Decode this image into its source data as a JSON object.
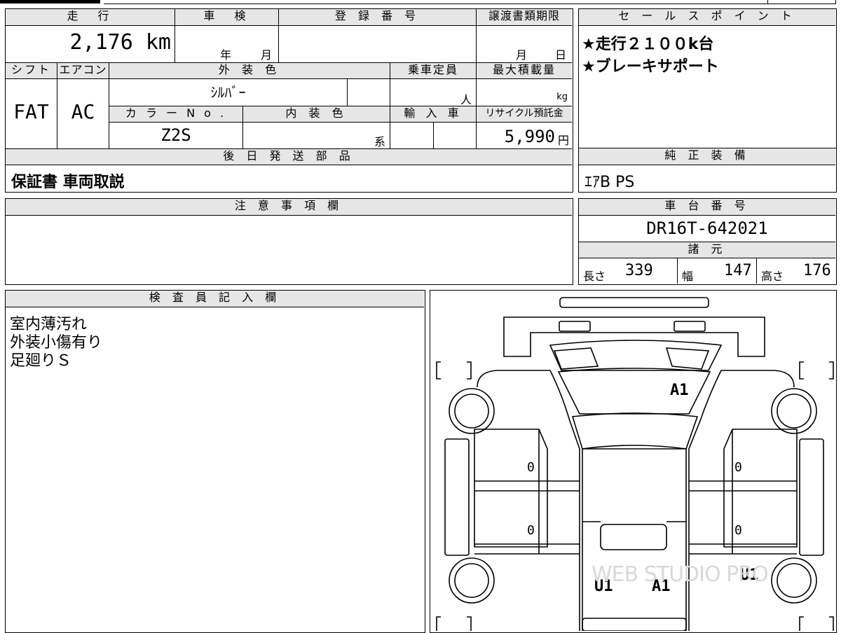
{
  "top_left": {
    "mileage_label": "走　行",
    "mileage_value": "2,176 km",
    "inspection_label": "車　検",
    "year_label": "年",
    "month_label": "月",
    "registration_label": "登 録 番 号",
    "transfer_label": "譲渡書類期限",
    "transfer_month": "月",
    "transfer_day": "日",
    "shift_label": "シフト",
    "ac_label": "エアコン",
    "exterior_label": "外 装 色",
    "capacity_label": "乗車定員",
    "capacity_unit": "人",
    "maxload_label": "最大積載量",
    "maxload_unit": "kg",
    "shift_value": "FAT",
    "ac_value": "AC",
    "exterior_value": "ｼﾙﾊﾞｰ",
    "color_no_label": "カ ラ ー  N o .",
    "interior_label": "内 装 色",
    "import_label": "輸 入 車",
    "recycle_label": "リサイクル預託金",
    "color_no_value": "Z2S",
    "interior_suffix": "系",
    "recycle_value": "5,990",
    "recycle_unit": "円",
    "later_parts_label": "後 日 発 送 部 品",
    "later_parts_value": "保証書 車両取説",
    "notes_label": "注 意 事 項 欄",
    "inspector_label": "検 査 員 記 入 欄",
    "inspector_lines": [
      "室内薄汚れ",
      "外装小傷有り",
      "足廻りＳ"
    ]
  },
  "right": {
    "sales_label": "セ ー ル ス ポ イ ン ト",
    "sales_lines": [
      "★走行２１００k台",
      "★ブレーキサポート"
    ],
    "equipment_label": "純 正 装 備",
    "equipment_value": "ｴｱB PS",
    "chassis_label": "車 台 番 号",
    "chassis_value": "DR16T-642021",
    "specs_label": "諸 元",
    "length_label": "長さ",
    "length_value": "339",
    "width_label": "幅",
    "width_value": "147",
    "height_label": "高さ",
    "height_value": "176"
  },
  "diagram": {
    "marks": {
      "a1_front": "A1",
      "u1_left": "U1",
      "a1_rear": "A1",
      "u1_right": "U1",
      "zero": "0"
    },
    "watermark": "WEB STUDIO PRO"
  }
}
